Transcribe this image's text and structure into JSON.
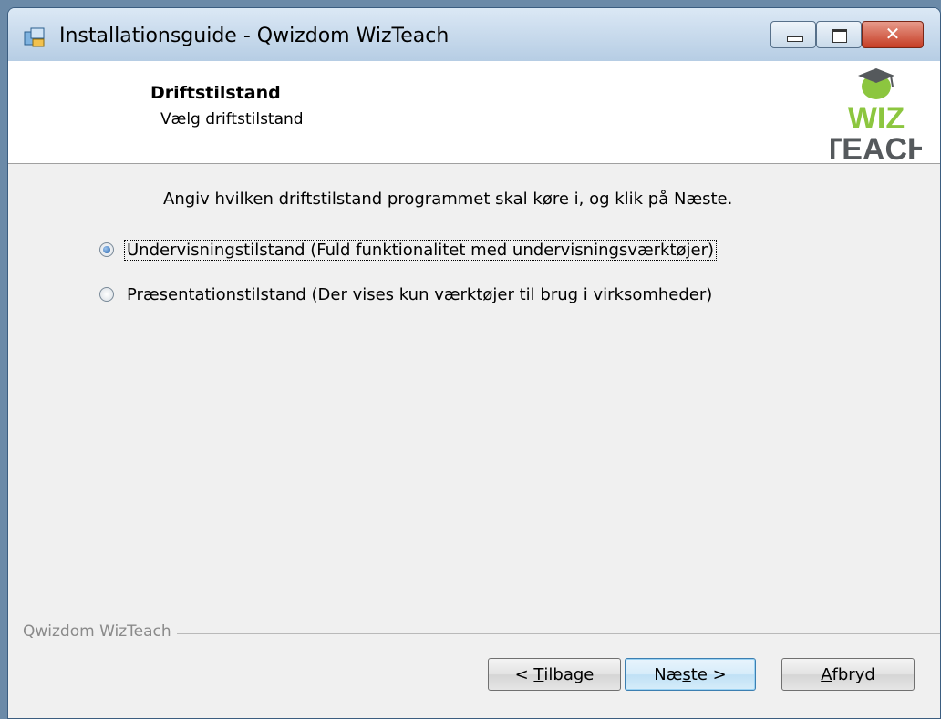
{
  "window": {
    "title": "Installationsguide - Qwizdom WizTeach",
    "controls": {
      "minimize_icon": "minimize-icon",
      "maximize_icon": "maximize-icon",
      "close_icon": "close-icon"
    }
  },
  "header": {
    "title": "Driftstilstand",
    "subtitle": "Vælg driftstilstand",
    "logo_line1": "WIZ",
    "logo_line2": "TEACH"
  },
  "main": {
    "instruction": "Angiv hvilken driftstilstand programmet skal køre i, og klik på Næste.",
    "options": [
      {
        "label": "Undervisningstilstand (Fuld funktionalitet med undervisningsværktøjer)",
        "selected": true
      },
      {
        "label": "Præsentationstilstand (Der vises kun værktøjer til brug i virksomheder)",
        "selected": false
      }
    ]
  },
  "footer": {
    "group_label": "Qwizdom WizTeach",
    "back_pre": "< ",
    "back_mnemonic": "T",
    "back_post": "ilbage",
    "next_pre": "Næ",
    "next_mnemonic": "s",
    "next_post": "te >",
    "cancel_mnemonic": "A",
    "cancel_post": "fbryd"
  },
  "colors": {
    "accent": "#1f5da8",
    "logo_green": "#8cc63f",
    "logo_gray": "#55595c"
  }
}
